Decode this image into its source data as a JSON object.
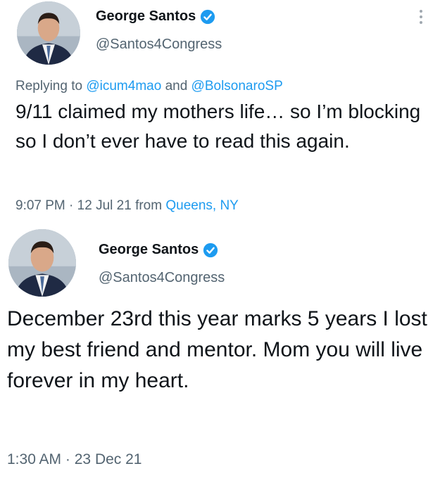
{
  "tweets": [
    {
      "display_name": "George Santos",
      "handle": "@Santos4Congress",
      "verified_icon": "verified-badge-icon",
      "replying_prefix": "Replying to",
      "replying_user1": "@icum4mao",
      "replying_and": "and",
      "replying_user2": "@BolsonaroSP",
      "text": "9/11 claimed my mothers life… so I’m blocking so I don’t ever have to read this again.",
      "time": "9:07 PM",
      "separator": "·",
      "date": "12 Jul 21",
      "from_label": "from",
      "location": "Queens, NY"
    },
    {
      "display_name": "George Santos",
      "handle": "@Santos4Congress",
      "verified_icon": "verified-badge-icon",
      "text": "December 23rd this year marks 5 years I lost my best friend and mentor. Mom you will live forever in my heart.",
      "time": "1:30 AM",
      "separator": "·",
      "date": "23 Dec 21"
    }
  ],
  "colors": {
    "link": "#1d9bf0",
    "secondary_text": "#536471",
    "primary_text": "#0f1419"
  }
}
